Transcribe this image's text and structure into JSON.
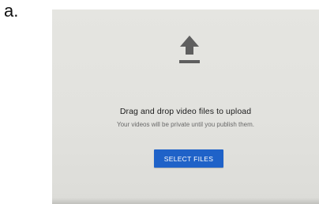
{
  "figure": {
    "label": "a."
  },
  "upload": {
    "icon": "upload-arrow-icon",
    "title": "Drag and drop video files to upload",
    "subtitle": "Your videos will be private until you publish them.",
    "button_label": "SELECT FILES"
  },
  "colors": {
    "background": "#e2e2de",
    "icon": "#5f5f5f",
    "button": "#1f62c8",
    "button_text": "#ffffff",
    "title_text": "#1c1c1c",
    "subtitle_text": "#6a6a6a"
  }
}
